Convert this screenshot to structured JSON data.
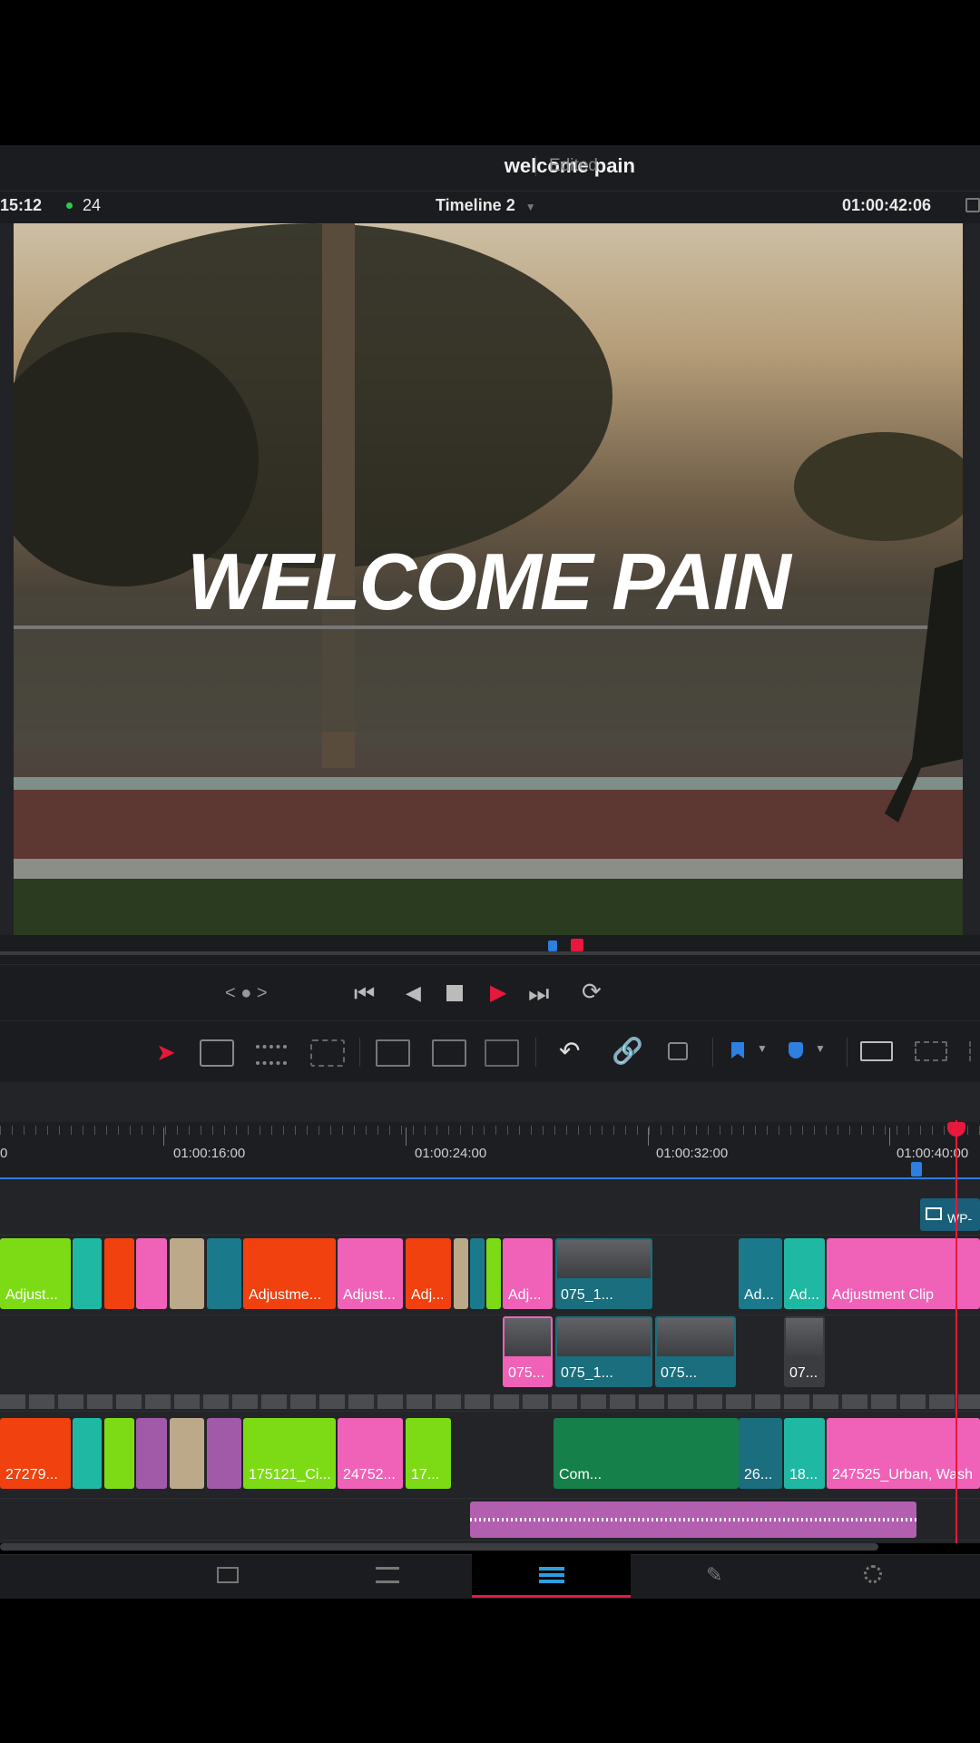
{
  "header": {
    "project_title": "welcome pain",
    "status": "Edited"
  },
  "infobar": {
    "left_timecode": "15:12",
    "frame_rate": "24",
    "timeline_name": "Timeline 2",
    "current_timecode": "01:00:42:06"
  },
  "viewer": {
    "overlay_title": "WELCOME PAIN"
  },
  "ruler": {
    "labels": [
      "01:00:16:00",
      "01:00:24:00",
      "01:00:32:00",
      "01:00:40:00"
    ]
  },
  "tracks": {
    "adjustment": [
      {
        "label": "Adjust...",
        "color": "#7ddb16"
      },
      {
        "label": "",
        "color": "#1fb8a3"
      },
      {
        "label": "",
        "color": "#f0410f"
      },
      {
        "label": "",
        "color": "#f062b7"
      },
      {
        "label": "",
        "color": "#bba98a"
      },
      {
        "label": "",
        "color": "#1a7a8c"
      },
      {
        "label": "Adjustme...",
        "color": "#f0410f"
      },
      {
        "label": "Adjust...",
        "color": "#f062b7"
      },
      {
        "label": "Adj...",
        "color": "#f0410f"
      },
      {
        "label": "",
        "color": "#bba98a"
      },
      {
        "label": "",
        "color": "#1a7a8c"
      },
      {
        "label": "",
        "color": "#7ddb16"
      },
      {
        "label": "Adj...",
        "color": "#f062b7"
      },
      {
        "label": "075_1...",
        "color": "#1a6e7d"
      },
      {
        "label": "Ad...",
        "color": "#1a7a8c"
      },
      {
        "label": "Ad...",
        "color": "#1fb8a3"
      },
      {
        "label": "Adjustment Clip",
        "color": "#f062b7"
      }
    ],
    "video2": [
      {
        "label": "075...",
        "color": "#f062b7"
      },
      {
        "label": "075_1...",
        "color": "#1a6e7d"
      },
      {
        "label": "075...",
        "color": "#1a6e7d"
      },
      {
        "label": "07...",
        "color": "#3a3c40"
      }
    ],
    "video1": [
      {
        "label": "27279...",
        "color": "#f0410f"
      },
      {
        "label": "",
        "color": "#1fb8a3"
      },
      {
        "label": "",
        "color": "#7ddb16"
      },
      {
        "label": "",
        "color": "#a05aa8"
      },
      {
        "label": "",
        "color": "#bba98a"
      },
      {
        "label": "",
        "color": "#a05aa8"
      },
      {
        "label": "175121_Ci...",
        "color": "#7ddb16"
      },
      {
        "label": "24752...",
        "color": "#f062b7"
      },
      {
        "label": "17...",
        "color": "#7ddb16"
      },
      {
        "label": "Com...",
        "color": "#15804a"
      },
      {
        "label": "26...",
        "color": "#1a6e7d"
      },
      {
        "label": "18...",
        "color": "#1fb8a3"
      },
      {
        "label": "247525_Urban, Wash",
        "color": "#f062b7"
      }
    ],
    "title_clip": "WP-"
  },
  "colors": {
    "accent_red": "#e8183c",
    "marker_blue": "#2d7fe0"
  }
}
